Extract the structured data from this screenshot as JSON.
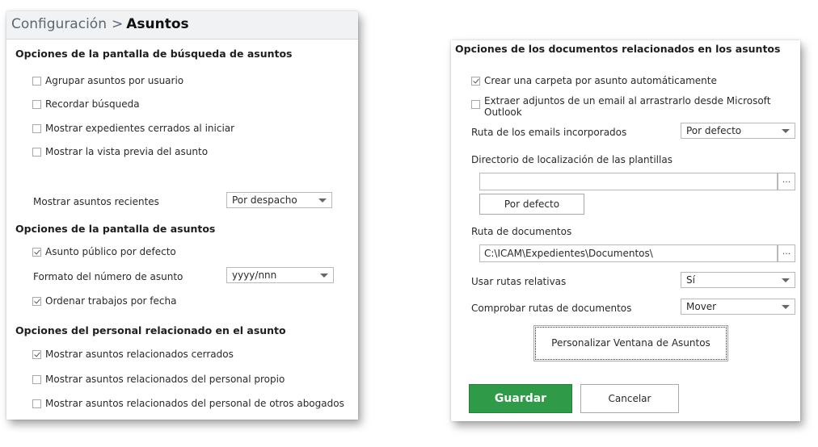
{
  "header": {
    "breadcrumb_parent": "Configuración",
    "breadcrumb_separator": ">",
    "breadcrumb_current": "Asuntos"
  },
  "search_options": {
    "title": "Opciones de la pantalla de búsqueda de asuntos",
    "items": [
      {
        "label": "Agrupar asuntos por usuario",
        "checked": false
      },
      {
        "label": "Recordar búsqueda",
        "checked": false
      },
      {
        "label": "Mostrar expedientes cerrados al iniciar",
        "checked": false
      },
      {
        "label": "Mostrar la vista previa del asunto",
        "checked": false
      }
    ],
    "recent_label": "Mostrar asuntos recientes",
    "recent_value": "Por despacho"
  },
  "matter_options": {
    "title": "Opciones de la pantalla de asuntos",
    "public_label": "Asunto público por defecto",
    "public_checked": true,
    "format_label": "Formato del número de asunto",
    "format_value": "yyyy/nnn",
    "sort_label": "Ordenar trabajos por fecha",
    "sort_checked": true
  },
  "staff_options": {
    "title": "Opciones del personal relacionado en el asunto",
    "items": [
      {
        "label": "Mostrar asuntos relacionados cerrados",
        "checked": true
      },
      {
        "label": "Mostrar asuntos relacionados del personal propio",
        "checked": false
      },
      {
        "label": "Mostrar asuntos relacionados del personal de otros abogados",
        "checked": false
      }
    ]
  },
  "documents_options": {
    "title": "Opciones de los documentos relacionados en los asuntos",
    "create_folder_label": "Crear una carpeta por asunto automáticamente",
    "create_folder_checked": true,
    "extract_line1": "Extraer adjuntos de un email al arrastrarlo desde Microsoft",
    "extract_line2": "Outlook",
    "extract_checked": false,
    "email_route_label": "Ruta de los emails incorporados",
    "email_route_value": "Por defecto",
    "templates_dir_label": "Directorio de localización de las plantillas",
    "templates_dir_value": "",
    "browse_label": "...",
    "default_button": "Por defecto",
    "docs_route_label": "Ruta de documentos",
    "docs_route_value": "C:\\ICAM\\Expedientes\\Documentos\\",
    "relative_label": "Usar rutas relativas",
    "relative_value": "Sí",
    "check_routes_label": "Comprobar rutas de documentos",
    "check_routes_value": "Mover",
    "customize_button": "Personalizar Ventana de Asuntos"
  },
  "actions": {
    "save": "Guardar",
    "cancel": "Cancelar"
  },
  "colors": {
    "primary_button": "#2f9a48",
    "titlebar_bg": "#f0f2f4"
  }
}
